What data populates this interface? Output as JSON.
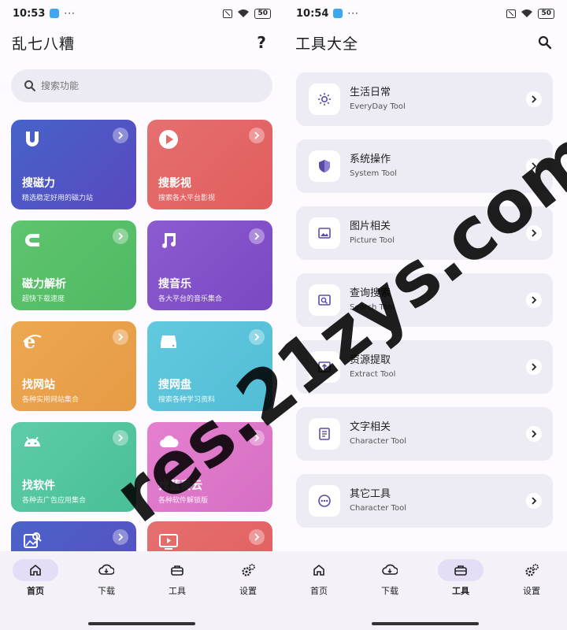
{
  "left": {
    "status": {
      "time": "10:53",
      "dots": "···",
      "battery": "50"
    },
    "header": {
      "title": "乱七八糟",
      "help_icon": "question-icon"
    },
    "search": {
      "placeholder": "搜索功能"
    },
    "cards": [
      {
        "title": "搜磁力",
        "subtitle": "精选稳定好用的磁力站",
        "icon": "magnet-u-icon",
        "color": "#4563c9"
      },
      {
        "title": "搜影视",
        "subtitle": "搜索各大平台影视",
        "icon": "play-icon",
        "color": "#e26a6a"
      },
      {
        "title": "磁力解析",
        "subtitle": "超快下载速度",
        "icon": "magnet-icon",
        "color": "#5cc26a"
      },
      {
        "title": "搜音乐",
        "subtitle": "各大平台的音乐集合",
        "icon": "music-note-icon",
        "color": "#8754c9"
      },
      {
        "title": "找网站",
        "subtitle": "各种实用网站集合",
        "icon": "ie-icon",
        "color": "#e9a14e"
      },
      {
        "title": "搜网盘",
        "subtitle": "搜索各种学习资料",
        "icon": "disk-icon",
        "color": "#5cc4da"
      },
      {
        "title": "找软件",
        "subtitle": "各种去广告应用集合",
        "icon": "android-icon",
        "color": "#52c6a0"
      },
      {
        "title": "找蓝奏云",
        "subtitle": "各种软件解锁版",
        "icon": "cloud-icon",
        "color": "#e079c8"
      },
      {
        "title": "",
        "subtitle": "",
        "icon": "image-search-icon",
        "color": "#4a63c9"
      },
      {
        "title": "",
        "subtitle": "",
        "icon": "tv-icon",
        "color": "#e26a6a"
      }
    ],
    "nav": [
      {
        "label": "首页",
        "icon": "home-icon",
        "active": true
      },
      {
        "label": "下载",
        "icon": "cloud-download-icon",
        "active": false
      },
      {
        "label": "工具",
        "icon": "toolbox-icon",
        "active": false
      },
      {
        "label": "设置",
        "icon": "gears-icon",
        "active": false
      }
    ]
  },
  "right": {
    "status": {
      "time": "10:54",
      "dots": "···",
      "battery": "50"
    },
    "header": {
      "title": "工具大全",
      "search_icon": "search-icon"
    },
    "tools": [
      {
        "name": "生活日常",
        "sub": "EveryDay Tool",
        "icon": "sun-icon"
      },
      {
        "name": "系统操作",
        "sub": "System Tool",
        "icon": "shield-icon"
      },
      {
        "name": "图片相关",
        "sub": "Picture Tool",
        "icon": "image-icon"
      },
      {
        "name": "查询搜索",
        "sub": "Search Tool",
        "icon": "image-search-icon"
      },
      {
        "name": "资源提取",
        "sub": "Extract Tool",
        "icon": "extract-icon"
      },
      {
        "name": "文字相关",
        "sub": "Character Tool",
        "icon": "document-icon"
      },
      {
        "name": "其它工具",
        "sub": "Character Tool",
        "icon": "more-icon"
      }
    ],
    "nav": [
      {
        "label": "首页",
        "icon": "home-icon",
        "active": false
      },
      {
        "label": "下载",
        "icon": "cloud-download-icon",
        "active": false
      },
      {
        "label": "工具",
        "icon": "toolbox-icon",
        "active": true
      },
      {
        "label": "设置",
        "icon": "gears-icon",
        "active": false
      }
    ]
  },
  "watermark": "res.21zys.com",
  "accent": "#5b4ba8"
}
